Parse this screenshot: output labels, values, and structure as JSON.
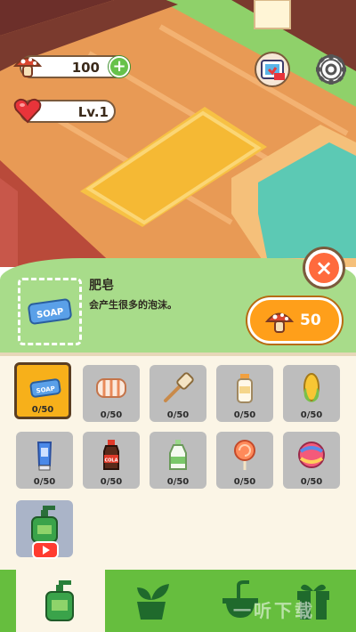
{
  "hud": {
    "coins": "100",
    "plus": "+",
    "level": "Lv.1"
  },
  "selected_item": {
    "name": "肥皂",
    "description": "会产生很多的泡沫。",
    "icon_text": "SOAP",
    "price": "50"
  },
  "close_label": "×",
  "items": [
    {
      "name": "soap",
      "count": "0/50"
    },
    {
      "name": "towel",
      "count": "0/50"
    },
    {
      "name": "bath-brush",
      "count": "0/50"
    },
    {
      "name": "milk-bottle",
      "count": "0/50"
    },
    {
      "name": "corn",
      "count": "0/50"
    },
    {
      "name": "lotion-tube",
      "count": "0/50"
    },
    {
      "name": "cola-bottle",
      "count": "0/50"
    },
    {
      "name": "drink-bottle",
      "count": "0/50"
    },
    {
      "name": "lollipop",
      "count": "0/50"
    },
    {
      "name": "candy-ball",
      "count": "0/50"
    }
  ],
  "item_icon_text": {
    "soap": "SOAP",
    "cola": "COLA"
  },
  "watermark": "一听下载",
  "nav": {
    "tabs": [
      "soap-dispenser",
      "plant",
      "sink",
      "gift"
    ],
    "active": 0
  },
  "colors": {
    "panel_green": "#a8dc8a",
    "panel_cream": "#fbf5e6",
    "nav_green": "#66be3e",
    "accent_orange": "#ff9f1a",
    "close_red": "#ff6a3d"
  }
}
